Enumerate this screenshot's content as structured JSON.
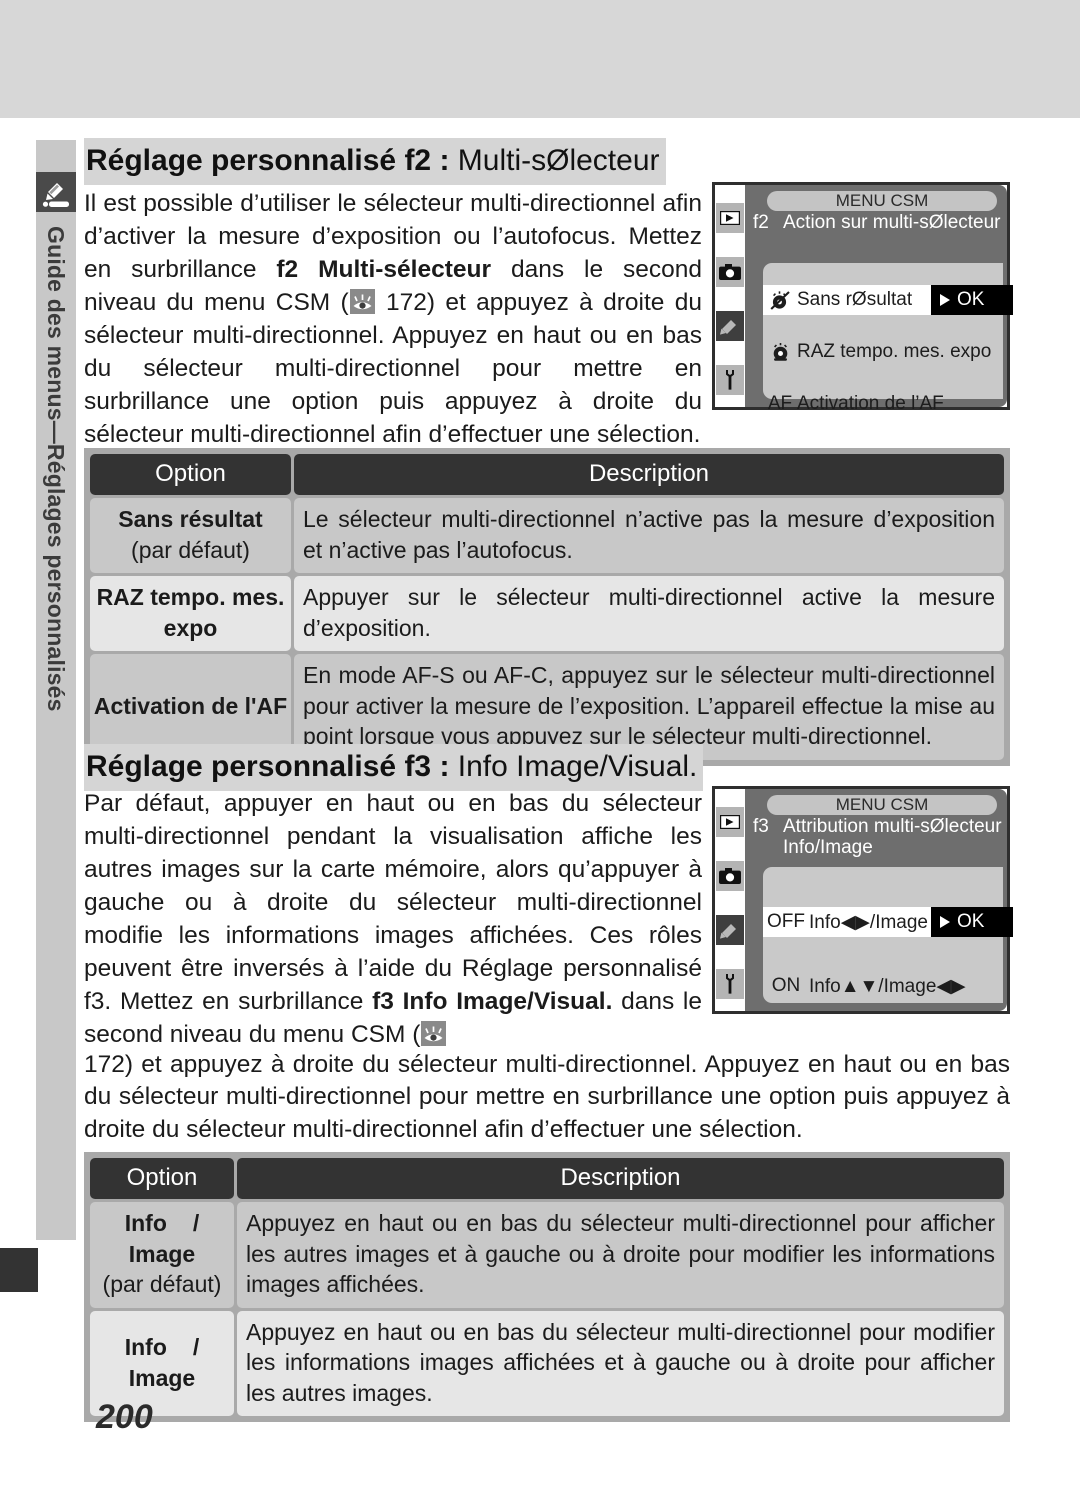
{
  "sidebar": {
    "label": "Guide des menus—Réglages personnalisés",
    "icon": "pencil-icon"
  },
  "page": {
    "number": "200"
  },
  "sections": [
    {
      "heading_bold": "Réglage personnalisé f2 :",
      "heading_light": " Multi-sØlecteur",
      "paragraph_1": "Il est possible d’utiliser le sélecteur multi-directionnel afin d’activer la mesure d’exposition ou l’autofocus. Mettez en surbrillance ",
      "paragraph_1_bold": "f2 Multi-sélecteur",
      "paragraph_2": " dans le second niveau du menu CSM (",
      "ref_icon": "eye-reference-icon",
      "paragraph_3": " 172) et appuyez à droite du sélecteur multi-directionnel. Appuyez en haut ou en bas du sélecteur multi-directionnel pour mettre en surbrillance une option puis appuyez à droite du sélecteur multi-directionnel afin d’effectuer une sélection.",
      "lcd": {
        "title": "MENU CSM",
        "tag": "f2",
        "heading": "Action sur multi-sØlecteur",
        "tabs": [
          "playback-icon",
          "camera-icon",
          "pencil-icon",
          "wrench-icon"
        ],
        "selected_tab_index": 2,
        "rows": [
          {
            "icon": "no-meter-icon",
            "label": "Sans rØsultat",
            "highlighted": true,
            "ok": "OK"
          },
          {
            "icon": "meter-reset-icon",
            "label": "RAZ tempo. mes. expo",
            "highlighted": false
          },
          {
            "icon": "AF",
            "label": "Activation de l’AF",
            "highlighted": false
          }
        ]
      },
      "table": {
        "headers": [
          "Option",
          "Description"
        ],
        "rows": [
          {
            "option": "Sans résultat",
            "option_sub": "(par défaut)",
            "description": "Le sélecteur multi-directionnel n’active pas la mesure d’exposition et n’active pas l’autofocus."
          },
          {
            "option": "RAZ tempo. mes. expo",
            "option_sub": "",
            "description": "Appuyer sur le sélecteur multi-directionnel active la mesure d’exposition."
          },
          {
            "option": "Activation de l'AF",
            "option_sub": "",
            "description": "En mode AF-S ou AF-C, appuyez sur le sélecteur multi-directionnel pour activer la mesure de l’exposition. L’appareil effectue la mise au point lorsque vous appuyez sur le sélecteur multi-directionnel."
          }
        ]
      }
    },
    {
      "heading_bold": "Réglage personnalisé f3 :",
      "heading_light": " Info Image/Visual.",
      "paragraph_1": "Par défaut, appuyer en haut ou en bas du sélecteur multi-directionnel pendant la visualisation affiche les autres images sur la carte mémoire, alors qu’appuyer à gauche ou à droite du sélecteur multi-directionnel modifie les informations images affichées. Ces rôles peuvent être inversés à l’aide du Réglage personnalisé f3. Mettez en surbrillance ",
      "paragraph_1_bold": "f3 Info Image/Visual.",
      "paragraph_2": " dans le second niveau du menu CSM (",
      "ref_icon": "eye-reference-icon",
      "paragraph_3": " 172) et appuyez à droite du sélecteur multi-directionnel. Appuyez en haut ou en bas du sélecteur multi-directionnel pour mettre en surbrillance une option puis appuyez à droite du sélecteur multi-directionnel afin d’effectuer une sélection.",
      "lcd": {
        "title": "MENU CSM",
        "tag": "f3",
        "heading": "Attribution multi-sØlecteur Info/Image",
        "tabs": [
          "playback-icon",
          "camera-icon",
          "pencil-icon",
          "wrench-icon"
        ],
        "selected_tab_index": 2,
        "rows": [
          {
            "icon": "OFF",
            "label": "Info◀▶/Image▲",
            "highlighted": true,
            "ok": "OK"
          },
          {
            "icon": "ON",
            "label": "Info▲▼/Image◀▶",
            "highlighted": false
          }
        ]
      },
      "table": {
        "headers": [
          "Option",
          "Description"
        ],
        "rows": [
          {
            "option_top": "Info",
            "option_slash": "/",
            "option_bottom": "Image",
            "option_sub": "(par défaut)",
            "description": "Appuyez en haut ou en bas du sélecteur multi-directionnel pour afficher les autres images et à gauche ou à droite pour modifier les informations images affichées."
          },
          {
            "option_top": "Info",
            "option_slash": "/",
            "option_bottom": "Image",
            "option_sub": "",
            "description": "Appuyez en haut ou en bas du sélecteur multi-directionnel pour modifier les informations images affichées et à gauche ou à droite pour afficher les autres images."
          }
        ]
      }
    }
  ]
}
